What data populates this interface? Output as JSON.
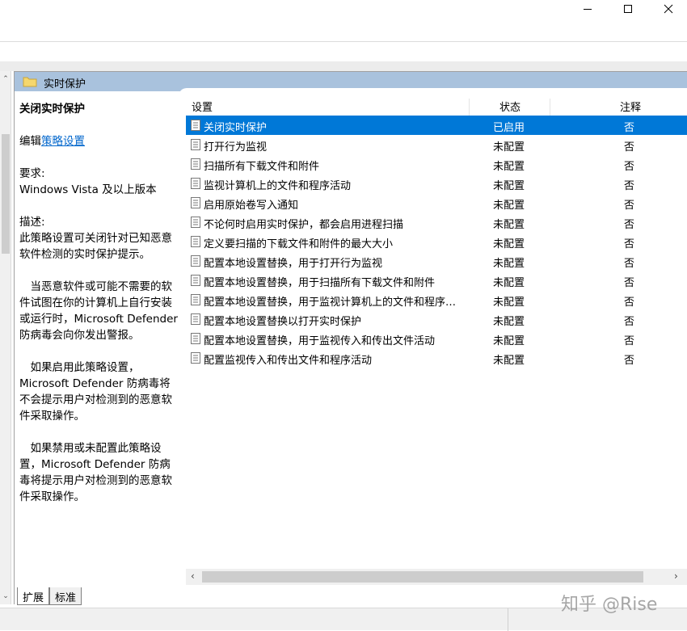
{
  "folder": {
    "title": "实时保护"
  },
  "description": {
    "heading": "关闭实时保护",
    "edit_prefix": "编辑",
    "edit_link": "策略设置",
    "requirements_label": "要求:",
    "requirements_value": "Windows Vista 及以上版本",
    "desc_label": "描述:",
    "desc_p1": "此策略设置可关闭针对已知恶意软件检测的实时保护提示。",
    "desc_p2": "当恶意软件或可能不需要的软件试图在你的计算机上自行安装或运行时，Microsoft Defender 防病毒会向你发出警报。",
    "desc_p3": "如果启用此策略设置，Microsoft Defender 防病毒将不会提示用户对检测到的恶意软件采取操作。",
    "desc_p4": "如果禁用或未配置此策略设置，Microsoft Defender 防病毒将提示用户对检测到的恶意软件采取操作。"
  },
  "table": {
    "columns": [
      "设置",
      "状态",
      "注释"
    ],
    "rows": [
      {
        "name": "关闭实时保护",
        "state": "已启用",
        "note": "否"
      },
      {
        "name": "打开行为监视",
        "state": "未配置",
        "note": "否"
      },
      {
        "name": "扫描所有下载文件和附件",
        "state": "未配置",
        "note": "否"
      },
      {
        "name": "监视计算机上的文件和程序活动",
        "state": "未配置",
        "note": "否"
      },
      {
        "name": "启用原始卷写入通知",
        "state": "未配置",
        "note": "否"
      },
      {
        "name": "不论何时启用实时保护，都会启用进程扫描",
        "state": "未配置",
        "note": "否"
      },
      {
        "name": "定义要扫描的下载文件和附件的最大大小",
        "state": "未配置",
        "note": "否"
      },
      {
        "name": "配置本地设置替换，用于打开行为监视",
        "state": "未配置",
        "note": "否"
      },
      {
        "name": "配置本地设置替换，用于扫描所有下载文件和附件",
        "state": "未配置",
        "note": "否"
      },
      {
        "name": "配置本地设置替换，用于监视计算机上的文件和程序活动",
        "state": "未配置",
        "note": "否"
      },
      {
        "name": "配置本地设置替换以打开实时保护",
        "state": "未配置",
        "note": "否"
      },
      {
        "name": "配置本地设置替换，用于监视传入和传出文件活动",
        "state": "未配置",
        "note": "否"
      },
      {
        "name": "配置监视传入和传出文件和程序活动",
        "state": "未配置",
        "note": "否"
      }
    ]
  },
  "tabs": [
    "扩展",
    "标准"
  ],
  "watermark": "知乎 @Rise",
  "colors": {
    "selection": "#0078d7",
    "header_band": "#a9c2dd",
    "link": "#0066cc"
  }
}
